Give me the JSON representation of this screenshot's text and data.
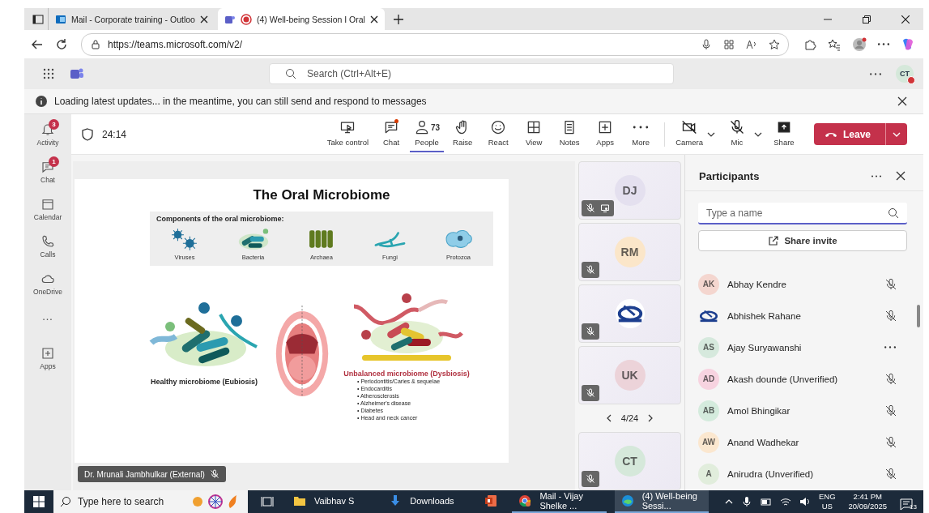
{
  "browser": {
    "tabs": [
      {
        "title": "Mail - Corporate training - Outloo",
        "selected": false
      },
      {
        "title": "(4) Well-being Session I Oral",
        "selected": true
      }
    ],
    "url": "https://teams.microsoft.com/v2/"
  },
  "teams_header": {
    "search_placeholder": "Search (Ctrl+Alt+E)",
    "avatar": "CT"
  },
  "notice": "Loading latest updates... in the meantime, you can still send and respond to messages",
  "rail": [
    {
      "label": "Activity",
      "badge": "3"
    },
    {
      "label": "Chat",
      "badge": "1"
    },
    {
      "label": "Calendar"
    },
    {
      "label": "Calls"
    },
    {
      "label": "OneDrive"
    },
    {
      "label": "…"
    },
    {
      "label": "Apps"
    }
  ],
  "meeting_toolbar": {
    "timer": "24:14",
    "items": [
      {
        "label": "Take control",
        "selected": false,
        "unread": false
      },
      {
        "label": "Chat",
        "selected": false,
        "unread": true
      },
      {
        "label": "People",
        "count": "73",
        "selected": true,
        "unread": false
      },
      {
        "label": "Raise",
        "selected": false,
        "unread": false
      },
      {
        "label": "React",
        "selected": false,
        "unread": false
      },
      {
        "label": "View",
        "selected": false,
        "unread": false
      },
      {
        "label": "Notes",
        "selected": false,
        "unread": false
      },
      {
        "label": "Apps",
        "selected": false,
        "unread": false
      },
      {
        "label": "More",
        "selected": false,
        "unread": false
      }
    ],
    "devices": [
      {
        "label": "Camera"
      },
      {
        "label": "Mic"
      },
      {
        "label": "Share"
      }
    ],
    "leave": "Leave"
  },
  "slide": {
    "title": "The Oral Microbiome",
    "components_heading": "Components of the oral microbiome:",
    "components": [
      "Viruses",
      "Bacteria",
      "Archaea",
      "Fungi",
      "Protozoa"
    ],
    "healthy_caption": "Healthy microbiome (Eubiosis)",
    "unbalanced_caption": "Unbalanced microbiome (Dysbiosis)",
    "conditions": [
      "• Periodontitis/Caries & sequelae",
      "• Endocarditis",
      "• Atherosclerosis",
      "• Alzheimer's disease",
      "• Diabetes",
      "• Head and neck cancer"
    ],
    "presenter": "Dr. Mrunali Jambhulkar (External)"
  },
  "video_tiles": [
    {
      "kind": "avatar",
      "initials": "DJ",
      "color": "#e4e0ef",
      "sharing": true
    },
    {
      "kind": "avatar",
      "initials": "RM",
      "color": "#fbe6c9",
      "sharing": false
    },
    {
      "kind": "logo",
      "sharing": false
    },
    {
      "kind": "avatar",
      "initials": "UK",
      "color": "#ecd3d9",
      "sharing": false
    }
  ],
  "pager": "4/24",
  "self_tile": {
    "initials": "CT",
    "color": "#d5e8da"
  },
  "participants": {
    "title": "Participants",
    "search_placeholder": "Type a name",
    "share_invite": "Share invite",
    "people": [
      {
        "initials": "AK",
        "name": "Abhay Kendre",
        "color": "#f4d6cf",
        "kind": "muted"
      },
      {
        "name": "Abhishek Rahane",
        "kind": "muted"
      },
      {
        "initials": "AS",
        "name": "Ajay Suryawanshi",
        "color": "#d6e9dd",
        "kind": "more"
      },
      {
        "initials": "AD",
        "name": "Akash dounde (Unverified)",
        "color": "#f7d3e0",
        "kind": "muted"
      },
      {
        "initials": "AB",
        "name": "Amol Bhingikar",
        "color": "#d4ebdd",
        "kind": "muted"
      },
      {
        "initials": "AW",
        "name": "Anand Wadhekar",
        "color": "#fbe7cf",
        "kind": "muted"
      },
      {
        "initials": "A",
        "name": "Anirudra (Unverified)",
        "color": "#e1eddc",
        "kind": "muted"
      }
    ]
  },
  "taskbar": {
    "search_placeholder": "Type here to search",
    "items": [
      {
        "label": "Vaibhav S",
        "kind": "folder",
        "selected": false
      },
      {
        "label": "Downloads",
        "kind": "download",
        "selected": false
      },
      {
        "kind": "slides",
        "selected": false
      },
      {
        "label": "Mail - Vijay Shelke ...",
        "kind": "chrome",
        "selected": false
      },
      {
        "label": "(4) Well-being Sessi...",
        "kind": "edge",
        "selected": true
      }
    ],
    "language": "ENG",
    "region": "US",
    "time": "2:41 PM",
    "date": "20/09/2025",
    "notifications": "13"
  }
}
